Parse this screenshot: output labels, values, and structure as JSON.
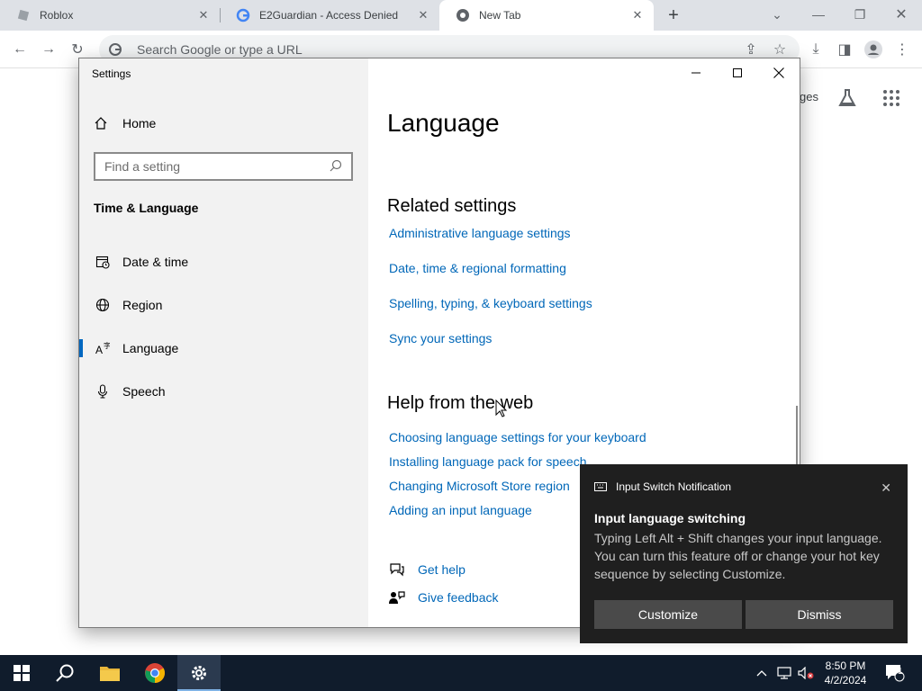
{
  "browser": {
    "tabs": [
      {
        "title": "Roblox"
      },
      {
        "title": "E2Guardian - Access Denied"
      },
      {
        "title": "New Tab"
      }
    ],
    "omnibox_placeholder": "Search Google or type a URL",
    "page_right_text": "ges"
  },
  "settings": {
    "window_title": "Settings",
    "home_label": "Home",
    "search_placeholder": "Find a setting",
    "category": "Time & Language",
    "nav": [
      {
        "label": "Date & time",
        "icon": "calendar-clock-icon"
      },
      {
        "label": "Region",
        "icon": "globe-icon"
      },
      {
        "label": "Language",
        "icon": "language-icon",
        "selected": true
      },
      {
        "label": "Speech",
        "icon": "microphone-icon"
      }
    ],
    "page_title": "Language",
    "related_heading": "Related settings",
    "related_links": [
      "Administrative language settings",
      "Date, time & regional formatting",
      "Spelling, typing, & keyboard settings",
      "Sync your settings"
    ],
    "help_heading": "Help from the web",
    "help_links": [
      "Choosing language settings for your keyboard",
      "Installing language pack for speech",
      "Changing Microsoft Store region",
      "Adding an input language"
    ],
    "get_help": "Get help",
    "give_feedback": "Give feedback"
  },
  "toast": {
    "app_name": "Input Switch Notification",
    "title": "Input language switching",
    "body": "Typing Left Alt + Shift changes your input language. You can turn this feature off or change your hot key sequence by selecting Customize.",
    "customize": "Customize",
    "dismiss": "Dismiss"
  },
  "taskbar": {
    "time": "8:50 PM",
    "date": "4/2/2024",
    "notification_count": "1"
  },
  "colors": {
    "link": "#0067b8",
    "accent": "#0067c0",
    "toast_bg": "#1f1f1f",
    "taskbar_bg": "#101c2c"
  }
}
